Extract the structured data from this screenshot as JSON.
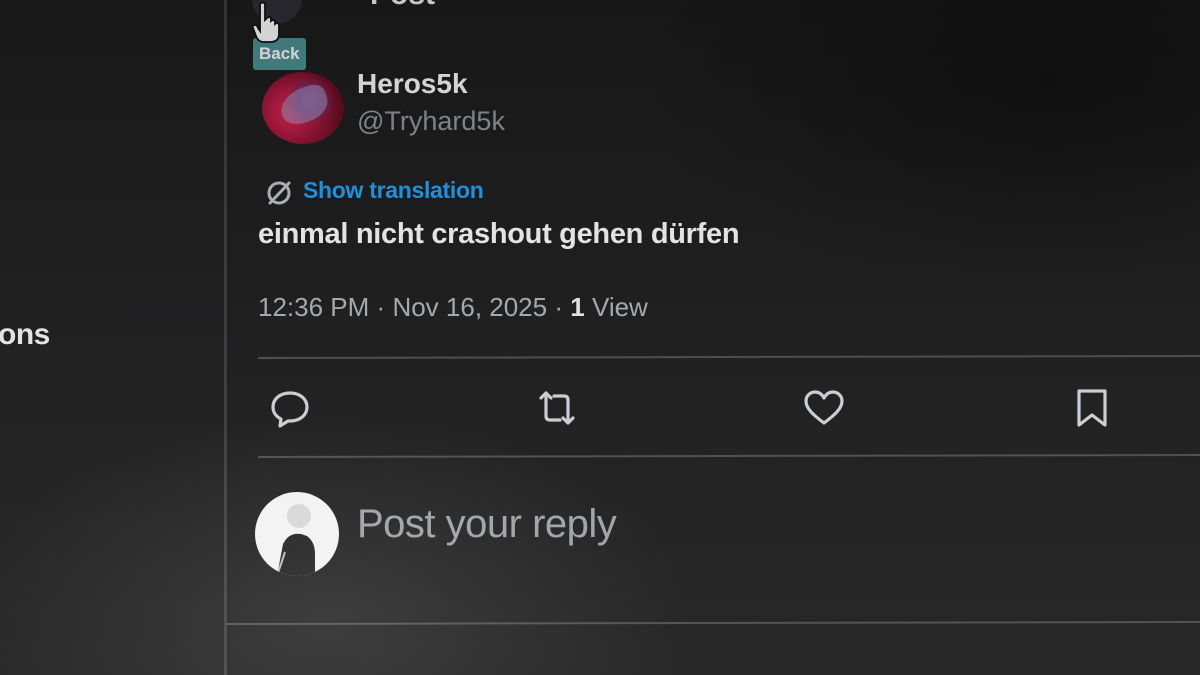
{
  "sidebar": {
    "partial_label": "ons"
  },
  "header": {
    "title": "Post",
    "back_tooltip": "Back"
  },
  "post": {
    "author": {
      "display_name": "Heros5k",
      "handle": "@Tryhard5k"
    },
    "show_translation_label": "Show translation",
    "text": "einmal nicht crashout gehen dürfen",
    "time": "12:36 PM",
    "date": "Nov 16, 2025",
    "views_count": "1",
    "views_label": "View",
    "separator": "·"
  },
  "actions": {
    "reply_icon": "speech-bubble-icon",
    "repost_icon": "repost-arrows-icon",
    "like_icon": "heart-icon",
    "bookmark_icon": "bookmark-icon"
  },
  "reply_box": {
    "placeholder": "Post your reply"
  },
  "colors": {
    "background": "#1b1b1c",
    "accent_link": "#1d9bf0",
    "text_primary": "#e7e9ea",
    "text_secondary": "#8b9096",
    "tooltip_bg": "#4a8b8c"
  }
}
